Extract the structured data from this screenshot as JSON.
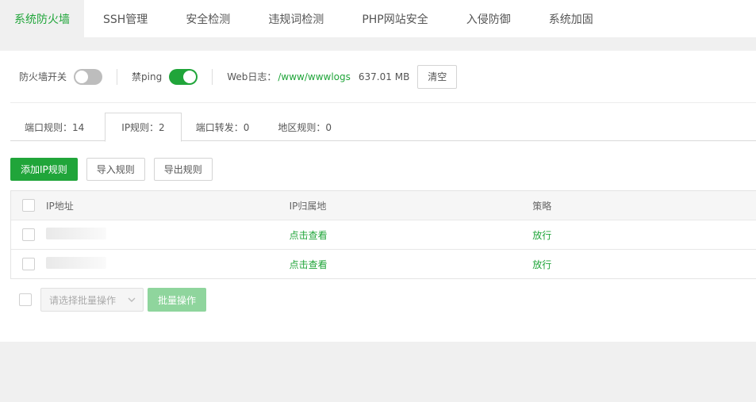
{
  "top_tabs": [
    {
      "label": "系统防火墙",
      "active": true
    },
    {
      "label": "SSH管理",
      "active": false
    },
    {
      "label": "安全检测",
      "active": false
    },
    {
      "label": "违规词检测",
      "active": false
    },
    {
      "label": "PHP网站安全",
      "active": false
    },
    {
      "label": "入侵防御",
      "active": false
    },
    {
      "label": "系统加固",
      "active": false
    }
  ],
  "settings": {
    "firewall_label": "防火墙开关",
    "firewall_on": false,
    "ping_label": "禁ping",
    "ping_on": true,
    "weblog_label": "Web日志：",
    "weblog_path": "/www/wwwlogs",
    "weblog_size": "637.01 MB",
    "clear_label": "清空"
  },
  "sub_tabs": [
    {
      "label": "端口规则：14",
      "active": false
    },
    {
      "label": "IP规则：2",
      "active": true
    },
    {
      "label": "端口转发：0",
      "active": false
    },
    {
      "label": "地区规则：0",
      "active": false
    }
  ],
  "actions": {
    "add_ip_rule": "添加IP规则",
    "import_rules": "导入规则",
    "export_rules": "导出规则"
  },
  "table": {
    "columns": [
      "IP地址",
      "IP归属地",
      "策略"
    ],
    "rows": [
      {
        "ip": "",
        "location_link": "点击查看",
        "policy": "放行"
      },
      {
        "ip": "",
        "location_link": "点击查看",
        "policy": "放行"
      }
    ]
  },
  "batch": {
    "select_placeholder": "请选择批量操作",
    "button_label": "批量操作"
  },
  "colors": {
    "accent": "#20a53a",
    "accent_disabled": "#8fd59d"
  }
}
